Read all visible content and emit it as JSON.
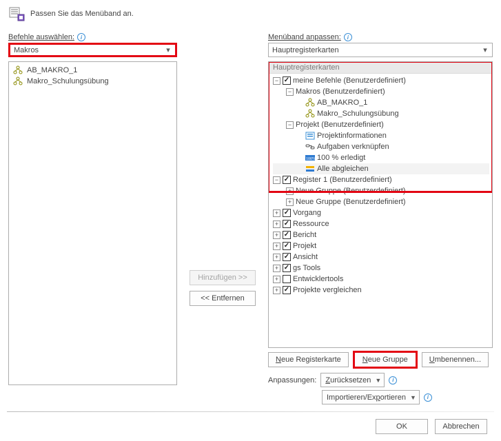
{
  "header": {
    "title": "Passen Sie das Menüband an."
  },
  "left": {
    "label": "Befehle auswählen:",
    "combo_value": "Makros",
    "items": [
      "AB_MAKRO_1",
      "Makro_Schulungsübung"
    ]
  },
  "mid": {
    "add": "Hinzufügen >>",
    "remove": "<< Entfernen"
  },
  "right": {
    "label": "Menüband anpassen:",
    "combo_value": "Hauptregisterkarten",
    "tree_header": "Hauptregisterkarten",
    "tree": {
      "meine_befehle": "meine Befehle (Benutzerdefiniert)",
      "makros_group": "Makros (Benutzerdefiniert)",
      "makro1": "AB_MAKRO_1",
      "makro2": "Makro_Schulungsübung",
      "projekt_group": "Projekt (Benutzerdefiniert)",
      "p1": "Projektinformationen",
      "p2": "Aufgaben verknüpfen",
      "p3": "100 % erledigt",
      "p4": "Alle abgleichen",
      "register1": "Register 1 (Benutzerdefiniert)",
      "ng1": "Neue Gruppe (Benutzerdefiniert)",
      "ng2": "Neue Gruppe (Benutzerdefiniert)",
      "vorgang": "Vorgang",
      "ressource": "Ressource",
      "bericht": "Bericht",
      "projekt": "Projekt",
      "ansicht": "Ansicht",
      "gstools": "gs Tools",
      "entwickler": "Entwicklertools",
      "vergleichen": "Projekte vergleichen"
    },
    "btn_new_tab": "Neue Registerkarte",
    "btn_new_group": "Neue Gruppe",
    "btn_rename": "Umbenennen...",
    "customizations": "Anpassungen:",
    "reset": "Zurücksetzen",
    "impexp": "Importieren/Exportieren"
  },
  "footer": {
    "ok": "OK",
    "cancel": "Abbrechen"
  }
}
